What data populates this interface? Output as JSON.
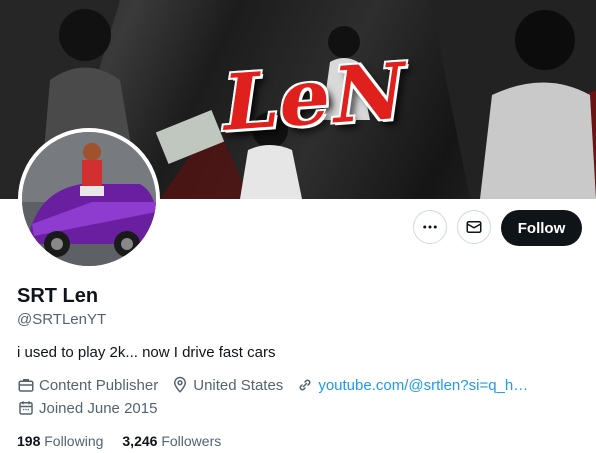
{
  "profile": {
    "display_name": "SRT Len",
    "handle": "@SRTLenYT",
    "bio": "i used to play 2k... now I drive fast cars",
    "category": "Content Publisher",
    "location": "United States",
    "website": "youtube.com/@srtlen?si=q_h…",
    "joined": "Joined June 2015"
  },
  "banner": {
    "word": "LeN",
    "accent_color": "#e0201c"
  },
  "actions": {
    "more_icon": "ellipsis-icon",
    "message_icon": "envelope-icon",
    "follow_label": "Follow"
  },
  "stats": {
    "following_count": "198",
    "following_label": "Following",
    "followers_count": "3,246",
    "followers_label": "Followers"
  },
  "colors": {
    "text": "#0f1419",
    "secondary": "#536471",
    "link": "#1d9bf0",
    "button": "#0f1419"
  }
}
